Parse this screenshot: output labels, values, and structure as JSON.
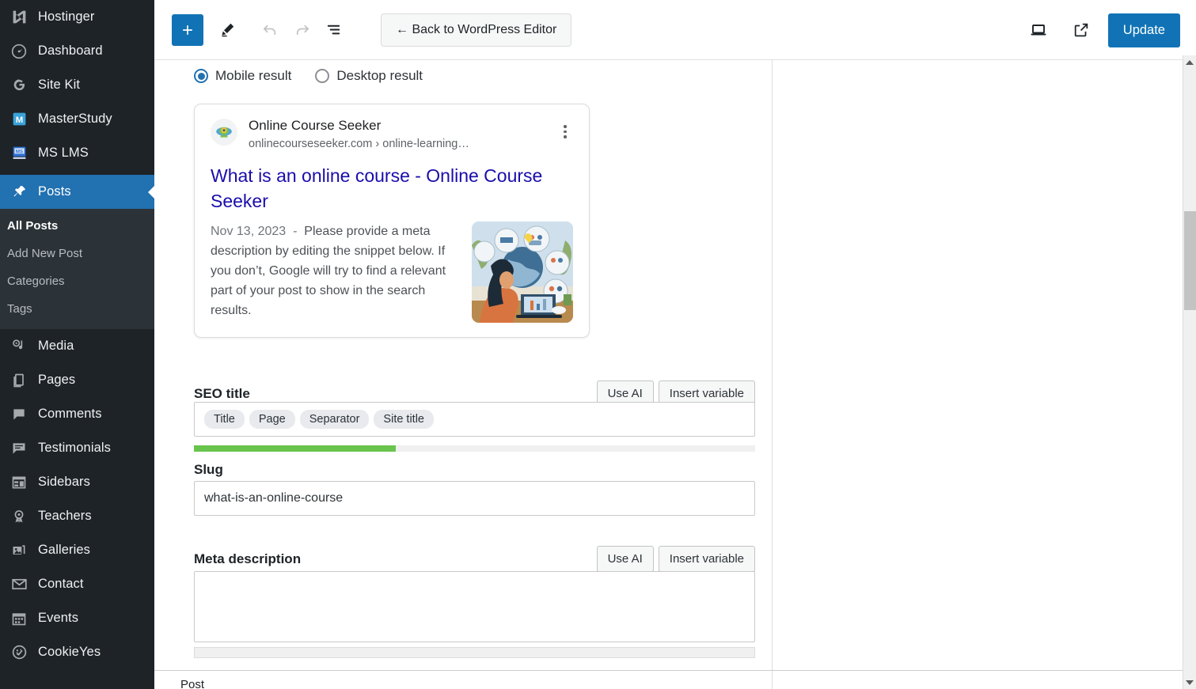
{
  "sidebar": {
    "items": [
      {
        "label": "Hostinger",
        "icon": "hostinger-icon",
        "active": false
      },
      {
        "label": "Dashboard",
        "icon": "dashboard-icon",
        "active": false
      },
      {
        "label": "Site Kit",
        "icon": "site-kit-icon",
        "active": false
      },
      {
        "label": "MasterStudy",
        "icon": "masterstudy-icon",
        "active": false
      },
      {
        "label": "MS LMS",
        "icon": "ms-lms-icon",
        "active": false
      },
      {
        "label": "Posts",
        "icon": "pin-icon",
        "active": true
      },
      {
        "label": "Media",
        "icon": "media-icon",
        "active": false
      },
      {
        "label": "Pages",
        "icon": "pages-icon",
        "active": false
      },
      {
        "label": "Comments",
        "icon": "comments-icon",
        "active": false
      },
      {
        "label": "Testimonials",
        "icon": "testimonials-icon",
        "active": false
      },
      {
        "label": "Sidebars",
        "icon": "sidebars-icon",
        "active": false
      },
      {
        "label": "Teachers",
        "icon": "teachers-icon",
        "active": false
      },
      {
        "label": "Galleries",
        "icon": "galleries-icon",
        "active": false
      },
      {
        "label": "Contact",
        "icon": "envelope-icon",
        "active": false
      },
      {
        "label": "Events",
        "icon": "calendar-icon",
        "active": false
      },
      {
        "label": "CookieYes",
        "icon": "cookieyes-icon",
        "active": false
      }
    ],
    "submenu": [
      {
        "label": "All Posts",
        "current": true
      },
      {
        "label": "Add New Post",
        "current": false
      },
      {
        "label": "Categories",
        "current": false
      },
      {
        "label": "Tags",
        "current": false
      }
    ],
    "accent_active": "#2271b1",
    "background": "#1d2327"
  },
  "toolbar": {
    "add_block_label": "+",
    "tools_label": "Edit",
    "undo_label": "Undo",
    "redo_label": "Redo",
    "list_view_label": "Document Overview",
    "back_label": "← Back to WordPress Editor",
    "view_label": "View",
    "preview_label": "Preview in new tab",
    "update_label": "Update",
    "accent": "#1173b5"
  },
  "seo_panel": {
    "preview_mode": {
      "options": [
        {
          "label": "Mobile result",
          "selected": true
        },
        {
          "label": "Desktop result",
          "selected": false
        }
      ]
    },
    "serp_preview": {
      "site_name": "Online Course Seeker",
      "site_url": "onlinecourseseeker.com › online-learning…",
      "title": "What is an online course - Online Course Seeker",
      "date": "Nov 13, 2023",
      "separator": "-",
      "description": "Please provide a meta description by editing the snippet below. If you don’t, Google will try to find a relevant part of your post to show in the search results.",
      "thumbnail_alt": "Woman studying at laptop with globe and online learning illustrations"
    },
    "seo_title": {
      "label": "SEO title",
      "use_ai_label": "Use AI",
      "insert_variable_label": "Insert variable",
      "variables": [
        "Title",
        "Page",
        "Separator",
        "Site title"
      ],
      "progress_percent": 36,
      "progress_color": "#69c44d"
    },
    "slug": {
      "label": "Slug",
      "value": "what-is-an-online-course"
    },
    "meta_description": {
      "label": "Meta description",
      "use_ai_label": "Use AI",
      "insert_variable_label": "Insert variable",
      "value": "",
      "progress_percent": 0
    }
  },
  "footer": {
    "post_label": "Post"
  }
}
